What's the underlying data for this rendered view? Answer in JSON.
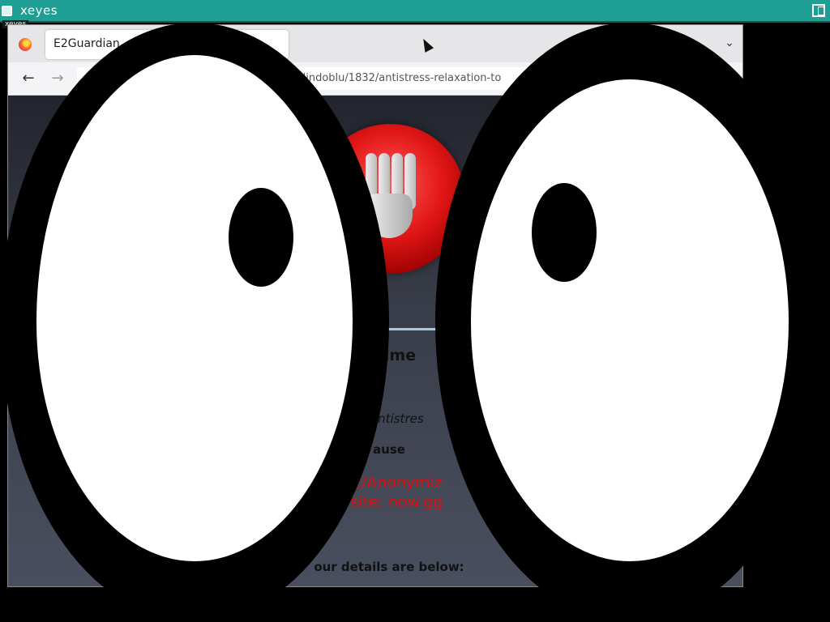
{
  "window": {
    "title": "xeyes",
    "underlabel": "xeyes",
    "titlebar_color": "#1f9e93"
  },
  "browser": {
    "tab_title": "E2Guardian -",
    "tab_list_icon": "chevron-down-icon",
    "back_icon": "arrow-left-icon",
    "forward_icon": "arrow-right-icon",
    "url": "dindoblu/1832/antistress-relaxation-to"
  },
  "blockpage": {
    "heading": "s time",
    "blocked_url": "/2/antistres",
    "because_label": "ause",
    "reason_line1": "sky/Anonymiz",
    "reason_line2": "d site: now.gg",
    "details_label": "our details are below:",
    "reason_color": "#e10d0d",
    "stop_icon": "stop-hand-icon"
  }
}
